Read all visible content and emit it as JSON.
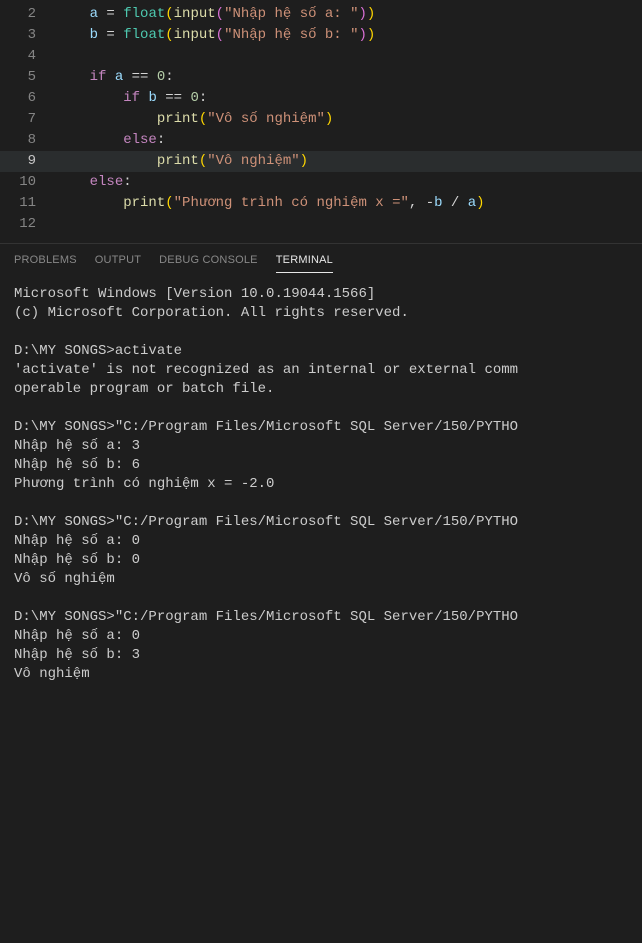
{
  "editor": {
    "lines": [
      {
        "num": "2",
        "tokens": [
          {
            "t": "    ",
            "c": ""
          },
          {
            "t": "a",
            "c": "var"
          },
          {
            "t": " = ",
            "c": "op"
          },
          {
            "t": "float",
            "c": "builtin"
          },
          {
            "t": "(",
            "c": "paren"
          },
          {
            "t": "input",
            "c": "fn"
          },
          {
            "t": "(",
            "c": "paren2"
          },
          {
            "t": "\"Nhập hệ số a: \"",
            "c": "str"
          },
          {
            "t": ")",
            "c": "paren2"
          },
          {
            "t": ")",
            "c": "paren"
          }
        ]
      },
      {
        "num": "3",
        "tokens": [
          {
            "t": "    ",
            "c": ""
          },
          {
            "t": "b",
            "c": "var"
          },
          {
            "t": " = ",
            "c": "op"
          },
          {
            "t": "float",
            "c": "builtin"
          },
          {
            "t": "(",
            "c": "paren"
          },
          {
            "t": "input",
            "c": "fn"
          },
          {
            "t": "(",
            "c": "paren2"
          },
          {
            "t": "\"Nhập hệ số b: \"",
            "c": "str"
          },
          {
            "t": ")",
            "c": "paren2"
          },
          {
            "t": ")",
            "c": "paren"
          }
        ]
      },
      {
        "num": "4",
        "tokens": []
      },
      {
        "num": "5",
        "tokens": [
          {
            "t": "    ",
            "c": ""
          },
          {
            "t": "if",
            "c": "kw"
          },
          {
            "t": " ",
            "c": ""
          },
          {
            "t": "a",
            "c": "var"
          },
          {
            "t": " == ",
            "c": "op"
          },
          {
            "t": "0",
            "c": "num"
          },
          {
            "t": ":",
            "c": "op"
          }
        ]
      },
      {
        "num": "6",
        "tokens": [
          {
            "t": "        ",
            "c": ""
          },
          {
            "t": "if",
            "c": "kw"
          },
          {
            "t": " ",
            "c": ""
          },
          {
            "t": "b",
            "c": "var"
          },
          {
            "t": " == ",
            "c": "op"
          },
          {
            "t": "0",
            "c": "num"
          },
          {
            "t": ":",
            "c": "op"
          }
        ]
      },
      {
        "num": "7",
        "tokens": [
          {
            "t": "            ",
            "c": ""
          },
          {
            "t": "print",
            "c": "fn"
          },
          {
            "t": "(",
            "c": "paren"
          },
          {
            "t": "\"Vô số nghiệm\"",
            "c": "str"
          },
          {
            "t": ")",
            "c": "paren"
          }
        ]
      },
      {
        "num": "8",
        "tokens": [
          {
            "t": "        ",
            "c": ""
          },
          {
            "t": "else",
            "c": "kw"
          },
          {
            "t": ":",
            "c": "op"
          }
        ]
      },
      {
        "num": "9",
        "active": true,
        "tokens": [
          {
            "t": "            ",
            "c": ""
          },
          {
            "t": "print",
            "c": "fn"
          },
          {
            "t": "(",
            "c": "paren"
          },
          {
            "t": "\"Vô nghiệm\"",
            "c": "str"
          },
          {
            "t": ")",
            "c": "paren"
          }
        ]
      },
      {
        "num": "10",
        "tokens": [
          {
            "t": "    ",
            "c": ""
          },
          {
            "t": "else",
            "c": "kw"
          },
          {
            "t": ":",
            "c": "op"
          }
        ]
      },
      {
        "num": "11",
        "tokens": [
          {
            "t": "        ",
            "c": ""
          },
          {
            "t": "print",
            "c": "fn"
          },
          {
            "t": "(",
            "c": "paren"
          },
          {
            "t": "\"Phương trình có nghiệm x =\"",
            "c": "str"
          },
          {
            "t": ", -",
            "c": "op"
          },
          {
            "t": "b",
            "c": "var"
          },
          {
            "t": " / ",
            "c": "op"
          },
          {
            "t": "a",
            "c": "var"
          },
          {
            "t": ")",
            "c": "paren"
          }
        ]
      },
      {
        "num": "12",
        "tokens": []
      }
    ]
  },
  "tabs": {
    "problems": "PROBLEMS",
    "output": "OUTPUT",
    "debug": "DEBUG CONSOLE",
    "terminal": "TERMINAL"
  },
  "terminal": {
    "lines": [
      "Microsoft Windows [Version 10.0.19044.1566]",
      "(c) Microsoft Corporation. All rights reserved.",
      "",
      "D:\\MY SONGS>activate",
      "'activate' is not recognized as an internal or external comm",
      "operable program or batch file.",
      "",
      "D:\\MY SONGS>\"C:/Program Files/Microsoft SQL Server/150/PYTHO",
      "Nhập hệ số a: 3",
      "Nhập hệ số b: 6",
      "Phương trình có nghiệm x = -2.0",
      "",
      "D:\\MY SONGS>\"C:/Program Files/Microsoft SQL Server/150/PYTHO",
      "Nhập hệ số a: 0",
      "Nhập hệ số b: 0",
      "Vô số nghiệm",
      "",
      "D:\\MY SONGS>\"C:/Program Files/Microsoft SQL Server/150/PYTHO",
      "Nhập hệ số a: 0",
      "Nhập hệ số b: 3",
      "Vô nghiệm"
    ]
  }
}
